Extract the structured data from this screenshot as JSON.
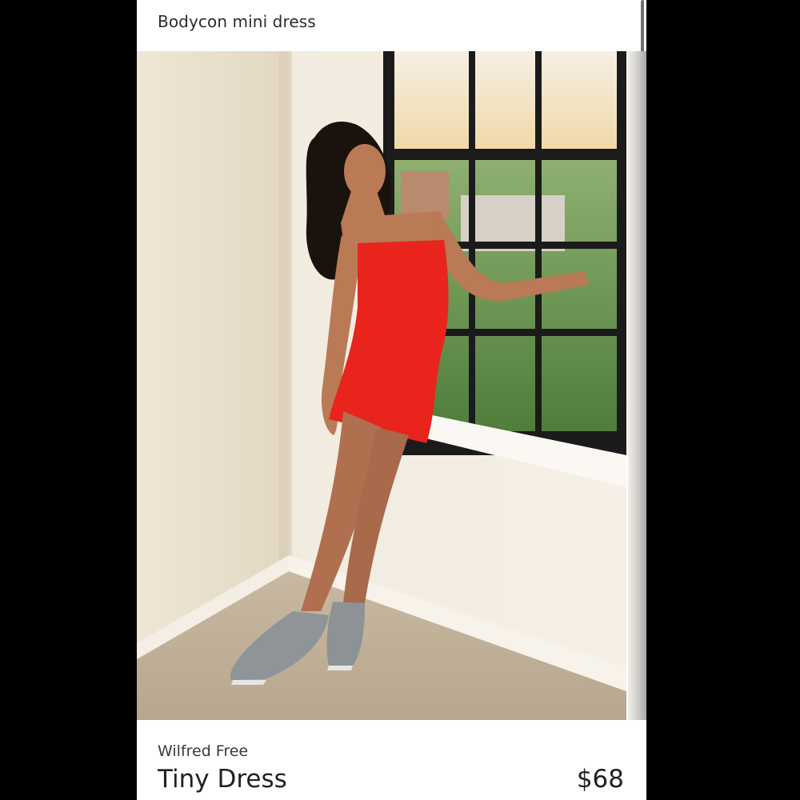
{
  "header": {
    "category": "Bodycon mini dress"
  },
  "product": {
    "brand": "Wilfred Free",
    "name": "Tiny Dress",
    "price": "$68"
  },
  "colors": {
    "dress": "#e8241d",
    "background": "#000000",
    "card": "#ffffff"
  }
}
